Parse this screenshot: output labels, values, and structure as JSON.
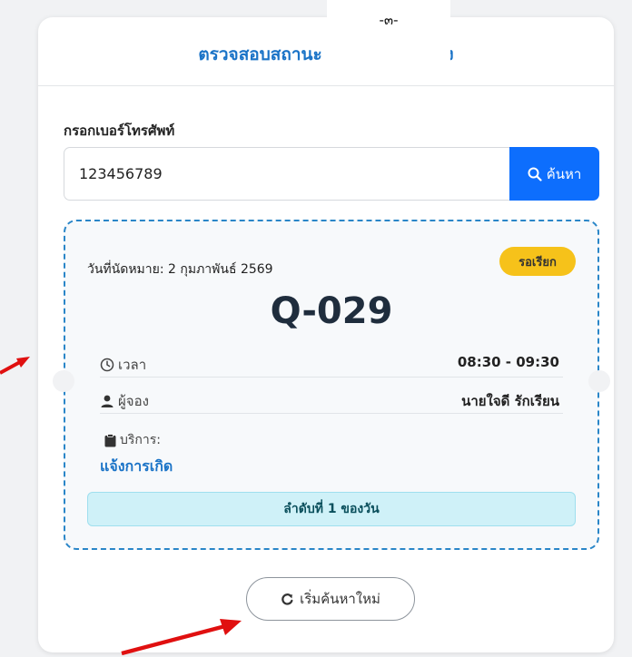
{
  "header": {
    "title": "ตรวจสอบสถานะ / ป",
    "title_tail": "อง",
    "overlay_text": "-๓-"
  },
  "search": {
    "label": "กรอกเบอร์โทรศัพท์",
    "value": "123456789",
    "button_label": "ค้นหา",
    "button_icon": "search-icon"
  },
  "appointment": {
    "date_label": "วันที่นัดหมาย: 2 กุมภาพันธ์ 2569",
    "status": "รอเรียก",
    "queue_number": "Q-029",
    "time_label": "เวลา",
    "time_value": "08:30 - 09:30",
    "booker_label": "ผู้จอง",
    "booker_value": "นายใจดี รักเรียน",
    "service_label": "บริการ:",
    "service_value": "แจ้งการเกิด",
    "order_text": "ลำดับที่ 1 ของวัน"
  },
  "actions": {
    "reset_label": "เริ่มค้นหาใหม่",
    "reset_icon": "refresh-icon"
  },
  "colors": {
    "primary": "#0d6efd",
    "title": "#1a73c7",
    "status_badge": "#f6c21a",
    "dashed_border": "#2a86c8",
    "banner_bg": "#cff1f8",
    "arrow": "#e01010"
  }
}
